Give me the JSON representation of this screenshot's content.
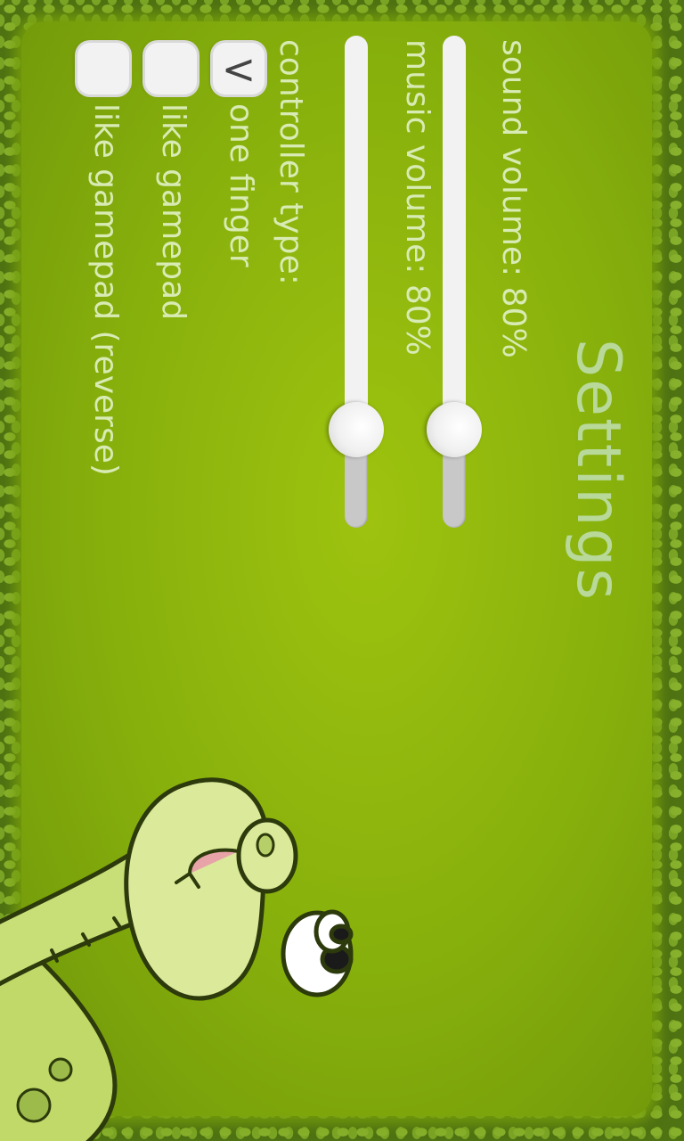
{
  "title": "Settings",
  "sound": {
    "label": "sound volume: 80%",
    "value": 0.8
  },
  "music": {
    "label": "music volume: 80%",
    "value": 0.8
  },
  "controller": {
    "label": "controller type:",
    "options": [
      {
        "label": "one finger",
        "checked": true
      },
      {
        "label": "like gamepad",
        "checked": false
      },
      {
        "label": "like gamepad (reverse)",
        "checked": false
      }
    ],
    "check_glyph": "<"
  },
  "mascot": "snake-mascot"
}
